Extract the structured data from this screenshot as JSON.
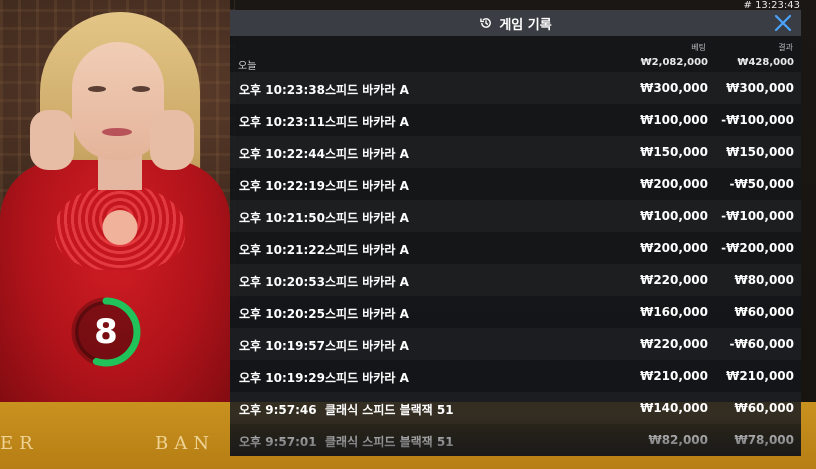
{
  "clock": "# 13:23:43",
  "panel": {
    "title": "게임 기록",
    "columns": {
      "bet": "베팅",
      "result": "결과"
    },
    "day": {
      "label": "오늘",
      "total_bet": "₩2,082,000",
      "total_result": "₩428,000"
    },
    "rows": [
      {
        "time": "오후 10:23:38",
        "game": "스피드 바카라 A",
        "bet": "₩300,000",
        "result": "₩300,000"
      },
      {
        "time": "오후 10:23:11",
        "game": "스피드 바카라 A",
        "bet": "₩100,000",
        "result": "-₩100,000"
      },
      {
        "time": "오후 10:22:44",
        "game": "스피드 바카라 A",
        "bet": "₩150,000",
        "result": "₩150,000"
      },
      {
        "time": "오후 10:22:19",
        "game": "스피드 바카라 A",
        "bet": "₩200,000",
        "result": "-₩50,000"
      },
      {
        "time": "오후 10:21:50",
        "game": "스피드 바카라 A",
        "bet": "₩100,000",
        "result": "-₩100,000"
      },
      {
        "time": "오후 10:21:22",
        "game": "스피드 바카라 A",
        "bet": "₩200,000",
        "result": "-₩200,000"
      },
      {
        "time": "오후 10:20:53",
        "game": "스피드 바카라 A",
        "bet": "₩220,000",
        "result": "₩80,000"
      },
      {
        "time": "오후 10:20:25",
        "game": "스피드 바카라 A",
        "bet": "₩160,000",
        "result": "₩60,000"
      },
      {
        "time": "오후 10:19:57",
        "game": "스피드 바카라 A",
        "bet": "₩220,000",
        "result": "-₩60,000"
      },
      {
        "time": "오후 10:19:29",
        "game": "스피드 바카라 A",
        "bet": "₩210,000",
        "result": "₩210,000"
      },
      {
        "time": "오후 9:57:46",
        "game": "클래식 스피드 블랙잭 51",
        "bet": "₩140,000",
        "result": "₩60,000"
      },
      {
        "time": "오후 9:57:01",
        "game": "클래식 스피드 블랙잭 51",
        "bet": "₩82,000",
        "result": "₩78,000"
      }
    ]
  },
  "timer": {
    "value": "8",
    "remaining_fraction": 0.55,
    "color": "#22c25a"
  },
  "table_text": {
    "left": "ER",
    "right": "BAN"
  },
  "colors": {
    "panel_header": "#3a3d43",
    "close_icon": "#4aa3ff"
  },
  "icons": {
    "history": "history-icon",
    "close": "close-icon"
  }
}
